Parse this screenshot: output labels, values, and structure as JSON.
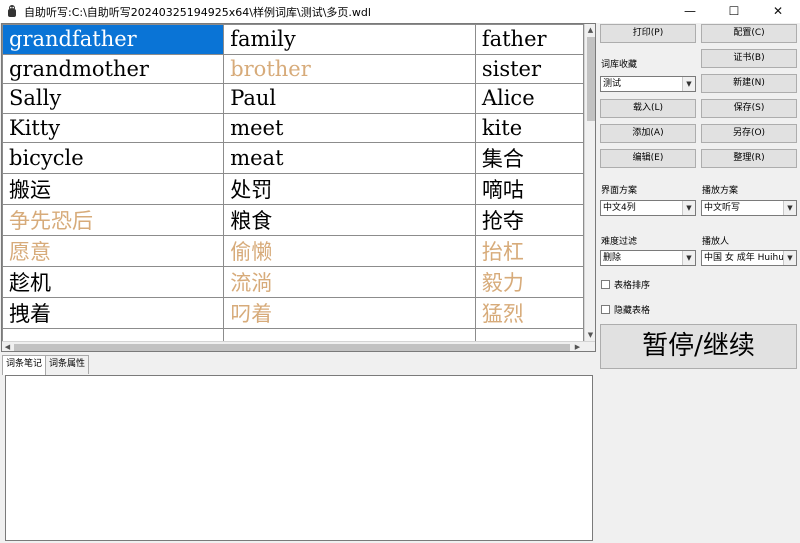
{
  "window": {
    "title": "自助听写:C:\\自助听写20240325194925x64\\样例词库\\测试\\多页.wdl",
    "minimize": "—",
    "maximize": "☐",
    "close": "✕"
  },
  "grid": {
    "rows": [
      [
        "grandfather",
        "family",
        "father"
      ],
      [
        "grandmother",
        "brother",
        "sister"
      ],
      [
        "Sally",
        "Paul",
        "Alice"
      ],
      [
        "Kitty",
        "meet",
        "kite"
      ],
      [
        "bicycle",
        "meat",
        "集合"
      ],
      [
        "搬运",
        "处罚",
        "嘀咕"
      ],
      [
        "争先恐后",
        "粮食",
        "抢夺"
      ],
      [
        "愿意",
        "偷懒",
        "抬杠"
      ],
      [
        "趁机",
        "流淌",
        "毅力"
      ],
      [
        "拽着",
        "叼着",
        "猛烈"
      ],
      [
        "",
        "",
        ""
      ]
    ],
    "highlight_color": "#d7ab7a",
    "selection_color": "#0a74d6"
  },
  "tabs": [
    "词条笔记",
    "词条属性"
  ],
  "notes_text": "",
  "right_panel": {
    "print": "打印(P)",
    "config": "配置(C)",
    "certificate": "证书(B)",
    "library_label": "词库收藏",
    "library_value": "测试",
    "new": "新建(N)",
    "load": "载入(L)",
    "save": "保存(S)",
    "add": "添加(A)",
    "save_as": "另存(O)",
    "edit": "编辑(E)",
    "organize": "整理(R)",
    "ui_scheme_label": "界面方案",
    "ui_scheme_value": "中文4列",
    "play_scheme_label": "播放方案",
    "play_scheme_value": "中文听写",
    "difficulty_label": "难度过滤",
    "difficulty_value": "删除",
    "speaker_label": "播放人",
    "speaker_value": "中国 女 成年  Huihu",
    "sort_label": "表格排序",
    "hide_label": "隐藏表格",
    "pause_resume": "暂停/继续"
  }
}
